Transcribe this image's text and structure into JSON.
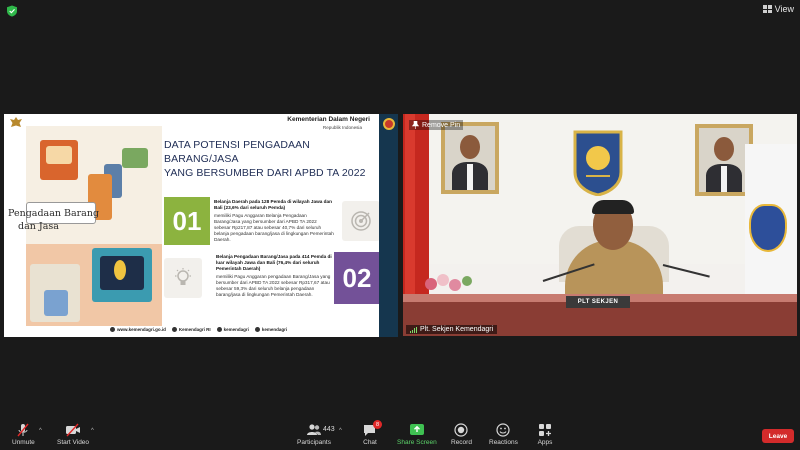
{
  "topbar": {
    "view_label": "View"
  },
  "shared_slide": {
    "ministry": "Kementerian Dalam Negeri",
    "ministry_sub": "Republik Indonesia",
    "illustration_label_1": "Pengadaan Barang",
    "illustration_label_2": "dan Jasa",
    "title_line1": "DATA POTENSI PENGADAAN BARANG/JASA",
    "title_line2": "YANG BERSUMBER DARI APBD TA 2022",
    "point1": {
      "number": "01",
      "heading": "Belanja Daerah pada 128 Pemda di wilayah Jawa dan Bali (23,6% dari seluruh Pemda)",
      "body": "memiliki Pagu Anggaran Belanja Pengadaan Barang/Jasa yang bersumber dari APBD TA 2022 sebesar Rp217,87 atau sebesar 40,7% dari seluruh belanja pengadaan barang/jasa di lingkungan Pemerintah Daerah."
    },
    "point2": {
      "number": "02",
      "heading": "Belanja Pengadaan Barang/Jasa pada 414 Pemda di luar wilayah Jawa dan Bali (76,4% dari seluruh Pemerintah Daerah)",
      "body": "memiliki Pagu Anggaran pengadaan Barang/Jasa yang bersumber dari APBD TA 2022 sebesar Rp317,67 atau sebesar 59,3% dari seluruh belanja pengadaan barang/jasa di lingkungan Pemerintah Daerah."
    },
    "footer": {
      "website": "www.kemendagri.go.id",
      "facebook": "Kemendagri RI",
      "twitter": "kemendagri",
      "instagram": "kemendagri"
    }
  },
  "video": {
    "pin_label": "Remove Pin",
    "nameplate": "PLT SEKJEN",
    "participant_name": "Plt. Sekjen Kemendagri"
  },
  "toolbar": {
    "unmute": "Unmute",
    "start_video": "Start Video",
    "participants": "Participants",
    "participant_count": "443",
    "chat": "Chat",
    "chat_badge": "8",
    "share_screen": "Share Screen",
    "record": "Record",
    "reactions": "Reactions",
    "apps": "Apps",
    "leave": "Leave"
  },
  "colors": {
    "background": "#1a1a1a",
    "share_green": "#5cd46a",
    "leave_red": "#d32b2b",
    "slide_green": "#8cb33f",
    "slide_purple": "#735198",
    "title_navy": "#1f2d55"
  }
}
